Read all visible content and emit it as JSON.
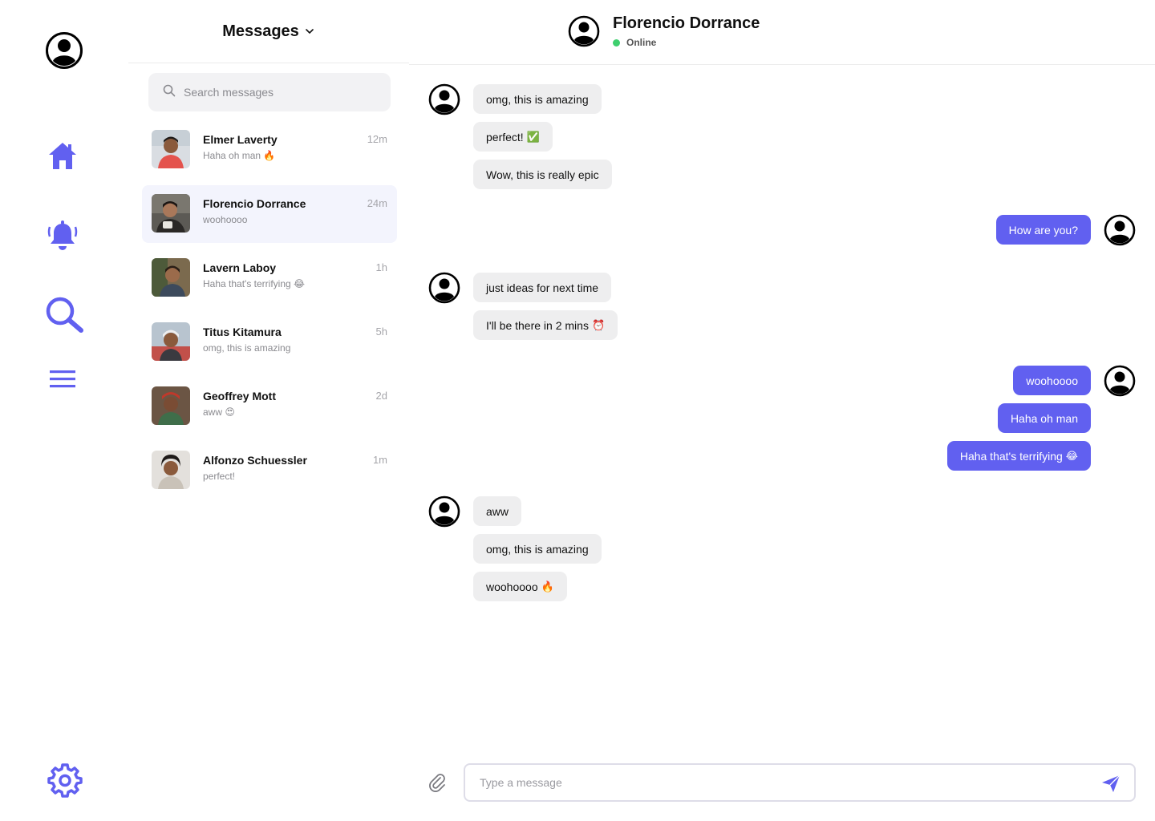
{
  "colors": {
    "accent": "#6160f0",
    "online": "#3ecf6e"
  },
  "rail": {
    "icons": [
      "user-avatar-icon",
      "home-icon",
      "bell-icon",
      "search-icon",
      "menu-icon",
      "gear-icon"
    ]
  },
  "list": {
    "title": "Messages",
    "search_placeholder": "Search messages",
    "conversations": [
      {
        "name": "Elmer Laverty",
        "preview": "Haha oh man",
        "emoji": "🔥",
        "time": "12m"
      },
      {
        "name": "Florencio Dorrance",
        "preview": "woohoooo",
        "emoji": "",
        "time": "24m",
        "active": true
      },
      {
        "name": "Lavern Laboy",
        "preview": "Haha that's terrifying",
        "emoji": "😂",
        "time": "1h"
      },
      {
        "name": "Titus Kitamura",
        "preview": "omg, this is amazing",
        "emoji": "",
        "time": "5h"
      },
      {
        "name": "Geoffrey Mott",
        "preview": "aww",
        "emoji": "😍",
        "time": "2d"
      },
      {
        "name": "Alfonzo Schuessler",
        "preview": "perfect!",
        "emoji": "",
        "time": "1m"
      }
    ]
  },
  "chat": {
    "contact_name": "Florencio Dorrance",
    "status": "Online",
    "messages": [
      {
        "dir": "in",
        "text": "omg, this is amazing",
        "emoji": ""
      },
      {
        "dir": "in",
        "text": "perfect!",
        "emoji": "✅"
      },
      {
        "dir": "in",
        "text": "Wow, this is really epic",
        "emoji": ""
      },
      {
        "dir": "out",
        "text": "How are you?",
        "emoji": ""
      },
      {
        "dir": "in",
        "text": "just ideas for next time",
        "emoji": ""
      },
      {
        "dir": "in",
        "text": "I'll be there in 2 mins",
        "emoji": "⏰"
      },
      {
        "dir": "out",
        "text": "woohoooo",
        "emoji": ""
      },
      {
        "dir": "out",
        "text": "Haha oh man",
        "emoji": ""
      },
      {
        "dir": "out",
        "text": "Haha that's terrifying",
        "emoji": "😂"
      },
      {
        "dir": "in",
        "text": "aww",
        "emoji": ""
      },
      {
        "dir": "in",
        "text": "omg, this is amazing",
        "emoji": ""
      },
      {
        "dir": "in",
        "text": "woohoooo",
        "emoji": "🔥"
      }
    ],
    "composer_placeholder": "Type a message"
  }
}
